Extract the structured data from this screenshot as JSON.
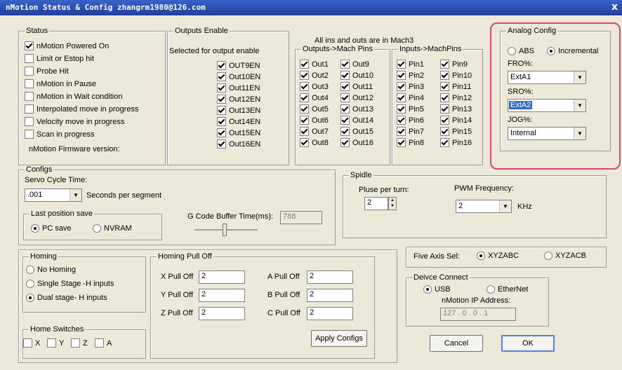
{
  "window": {
    "title": "nMotion Status & Config zhangrm1980@126.com",
    "close": "x"
  },
  "status": {
    "legend": "Status",
    "items": [
      {
        "label": "nMotion Powered On",
        "checked": true
      },
      {
        "label": "Limit or Estop hit",
        "checked": false
      },
      {
        "label": "Probe Hit",
        "checked": false
      },
      {
        "label": "nMotion in Pause",
        "checked": false
      },
      {
        "label": "nMotion in Wait condition",
        "checked": false
      },
      {
        "label": "Interpolated move in progress",
        "checked": false
      },
      {
        "label": "Velocity move in progress",
        "checked": false
      },
      {
        "label": "Scan in progress",
        "checked": false
      }
    ],
    "firmware_label": "nMotion Firmware version:"
  },
  "outputs_enable": {
    "legend": "Outputs Enable",
    "caption": "Selected for output enable",
    "items": [
      "OUT9EN",
      "Out10EN",
      "Out11EN",
      "Out12EN",
      "Out13EN",
      "Out14EN",
      "Out15EN",
      "Out16EN"
    ]
  },
  "mach_note": "All ins and outs are in Mach3",
  "outputs_mach": {
    "legend": "Outputs->Mach Pins",
    "col1": [
      "Out1",
      "Out2",
      "Out3",
      "Out4",
      "Out5",
      "Out6",
      "Out7",
      "Out8"
    ],
    "col2": [
      "Out9",
      "Out10",
      "Out11",
      "Out12",
      "Out13",
      "Out14",
      "Out15",
      "Out16"
    ]
  },
  "inputs_mach": {
    "legend": "Inputs->MachPins",
    "col1": [
      "Pin1",
      "Pin2",
      "Pin3",
      "Pin4",
      "Pin5",
      "Pin6",
      "Pin7",
      "Pin8"
    ],
    "col2": [
      "Pin9",
      "Pin10",
      "Pin11",
      "Pin12",
      "Pin13",
      "Pin14",
      "Pin15",
      "Pin16"
    ]
  },
  "analog": {
    "legend": "Analog Config",
    "abs": "ABS",
    "incremental": "Incremental",
    "mode": "incremental",
    "fro_label": "FRO%:",
    "fro_value": "ExtA1",
    "sro_label": "SRO%:",
    "sro_value": "ExtA2",
    "jog_label": "JOG%:",
    "jog_value": "Internal"
  },
  "configs": {
    "legend": "Configs",
    "servo_label": "Servo Cycle Time:",
    "servo_value": ".001",
    "servo_unit": "Seconds per segment",
    "last_pos_legend": "Last position save",
    "pc_save": "PC save",
    "nvram": "NVRAM",
    "last_pos": "pc",
    "gcode_label": "G Code Buffer Time(ms):",
    "gcode_value": "788"
  },
  "spindle": {
    "legend": "Spidle",
    "pulse_label": "Pluse per turn:",
    "pulse_value": "2",
    "pwm_label": "PWM Frequency:",
    "pwm_value": "2",
    "pwm_unit": "KHz"
  },
  "homing": {
    "legend": "Homing",
    "options": [
      "No Homing",
      "Single Stage -H inputs",
      "Dual stage- H inputs"
    ],
    "selected": 2
  },
  "home_switches": {
    "legend": "Home Switches",
    "items": [
      "X",
      "Y",
      "Z",
      "A"
    ]
  },
  "pull_off": {
    "legend": "Homing Pull Off",
    "x_label": "X Pull Off",
    "x_value": "2",
    "y_label": "Y Pull Off",
    "y_value": "2",
    "z_label": "Z Pull Off",
    "z_value": "2",
    "a_label": "A Pull Off",
    "a_value": "2",
    "b_label": "B Pull Off",
    "b_value": "2",
    "c_label": "C Pull Off",
    "c_value": "2",
    "apply": "Apply Configs"
  },
  "five_axis": {
    "label": "Five Axis Sel:",
    "opt1": "XYZABC",
    "opt2": "XYZACB",
    "selected": "XYZABC"
  },
  "device": {
    "legend": "Deivce Connect",
    "usb": "USB",
    "ethernet": "EtherNet",
    "selected": "USB",
    "ip_label": "nMotion IP Address:",
    "ip_value": "127 . 0 . 0 . 1"
  },
  "buttons": {
    "cancel": "Cancel",
    "ok": "OK"
  }
}
